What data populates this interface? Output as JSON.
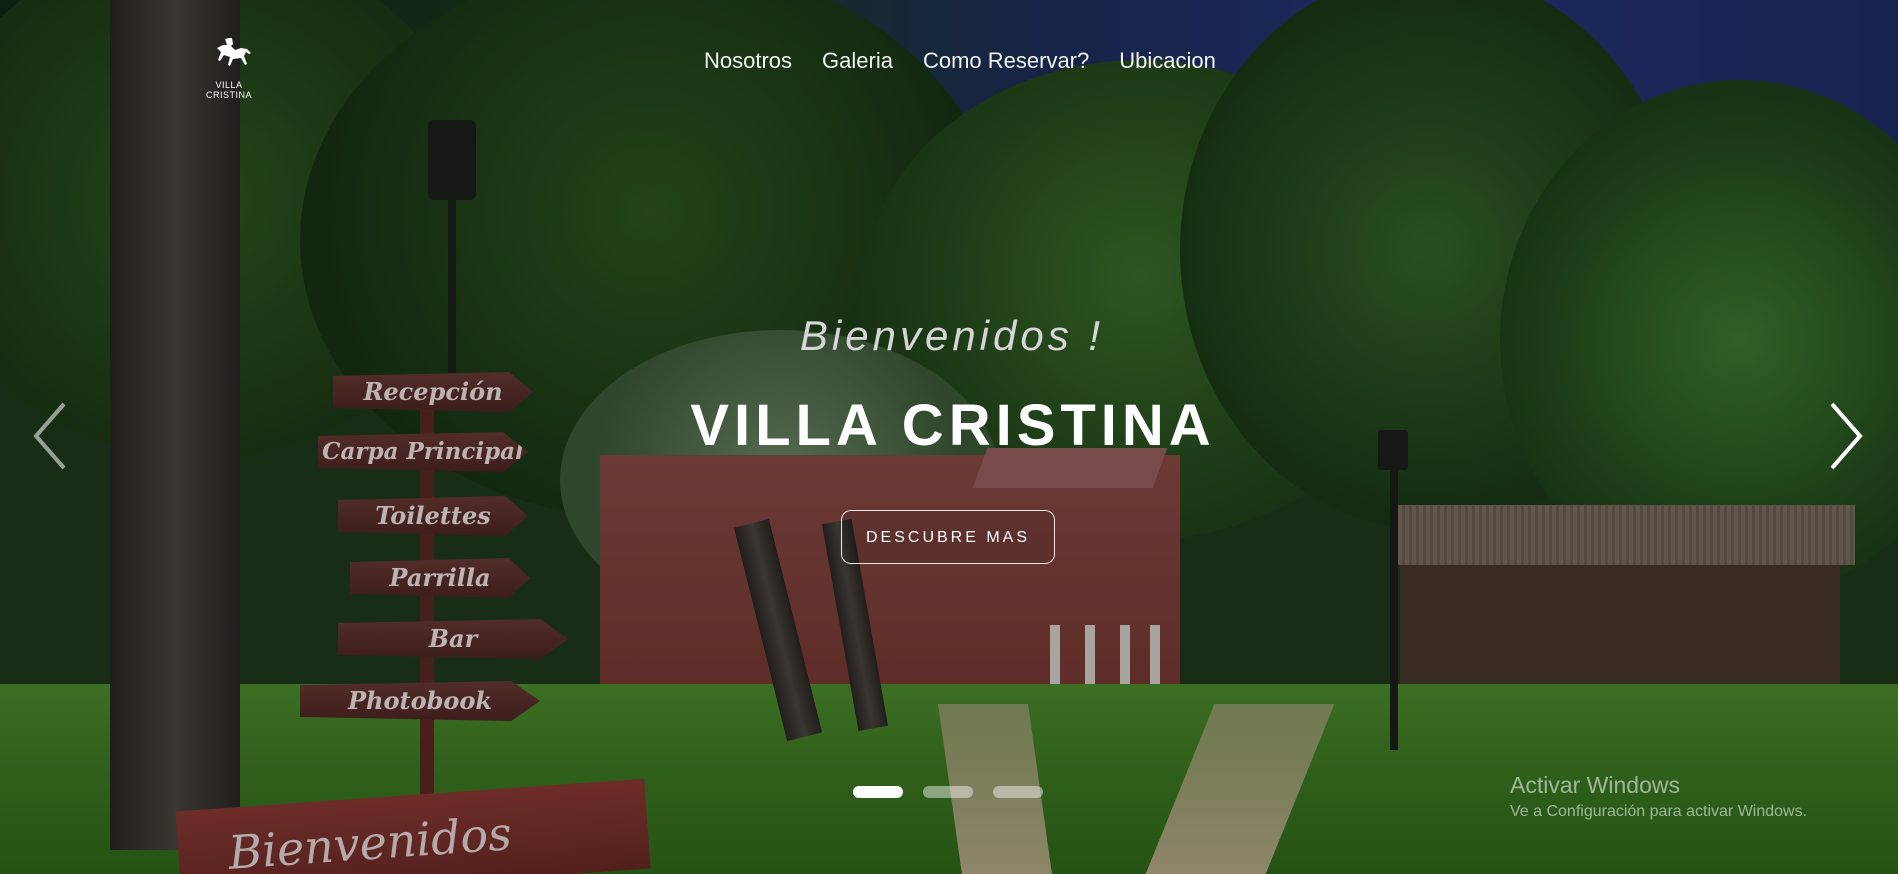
{
  "brand": {
    "logo_text": "VILLA CRISTINA"
  },
  "nav": {
    "items": [
      {
        "label": "Nosotros"
      },
      {
        "label": "Galeria"
      },
      {
        "label": "Como Reservar?"
      },
      {
        "label": "Ubicacion"
      }
    ]
  },
  "hero": {
    "greeting": "Bienvenidos !",
    "title": "VILLA CRISTINA",
    "cta_label": "DESCUBRE MAS",
    "slide_count": 3,
    "active_slide": 1
  },
  "signpost": {
    "labels": [
      "Recepción",
      "Carpa Principal",
      "Toilettes",
      "Parrilla",
      "Bar",
      "Photobook"
    ],
    "welcome_board": "Bienvenidos"
  },
  "watermark": {
    "title": "Activar Windows",
    "subtitle": "Ve a Configuración para activar Windows."
  },
  "colors": {
    "nav_text": "#f2f2f2",
    "cta_border": "#ffffff",
    "dot_active": "#ffffff",
    "dot_inactive": "rgba(255,255,255,0.45)"
  },
  "icons": {
    "logo": "horse-rider-icon",
    "prev": "chevron-left-icon",
    "next": "chevron-right-icon"
  }
}
